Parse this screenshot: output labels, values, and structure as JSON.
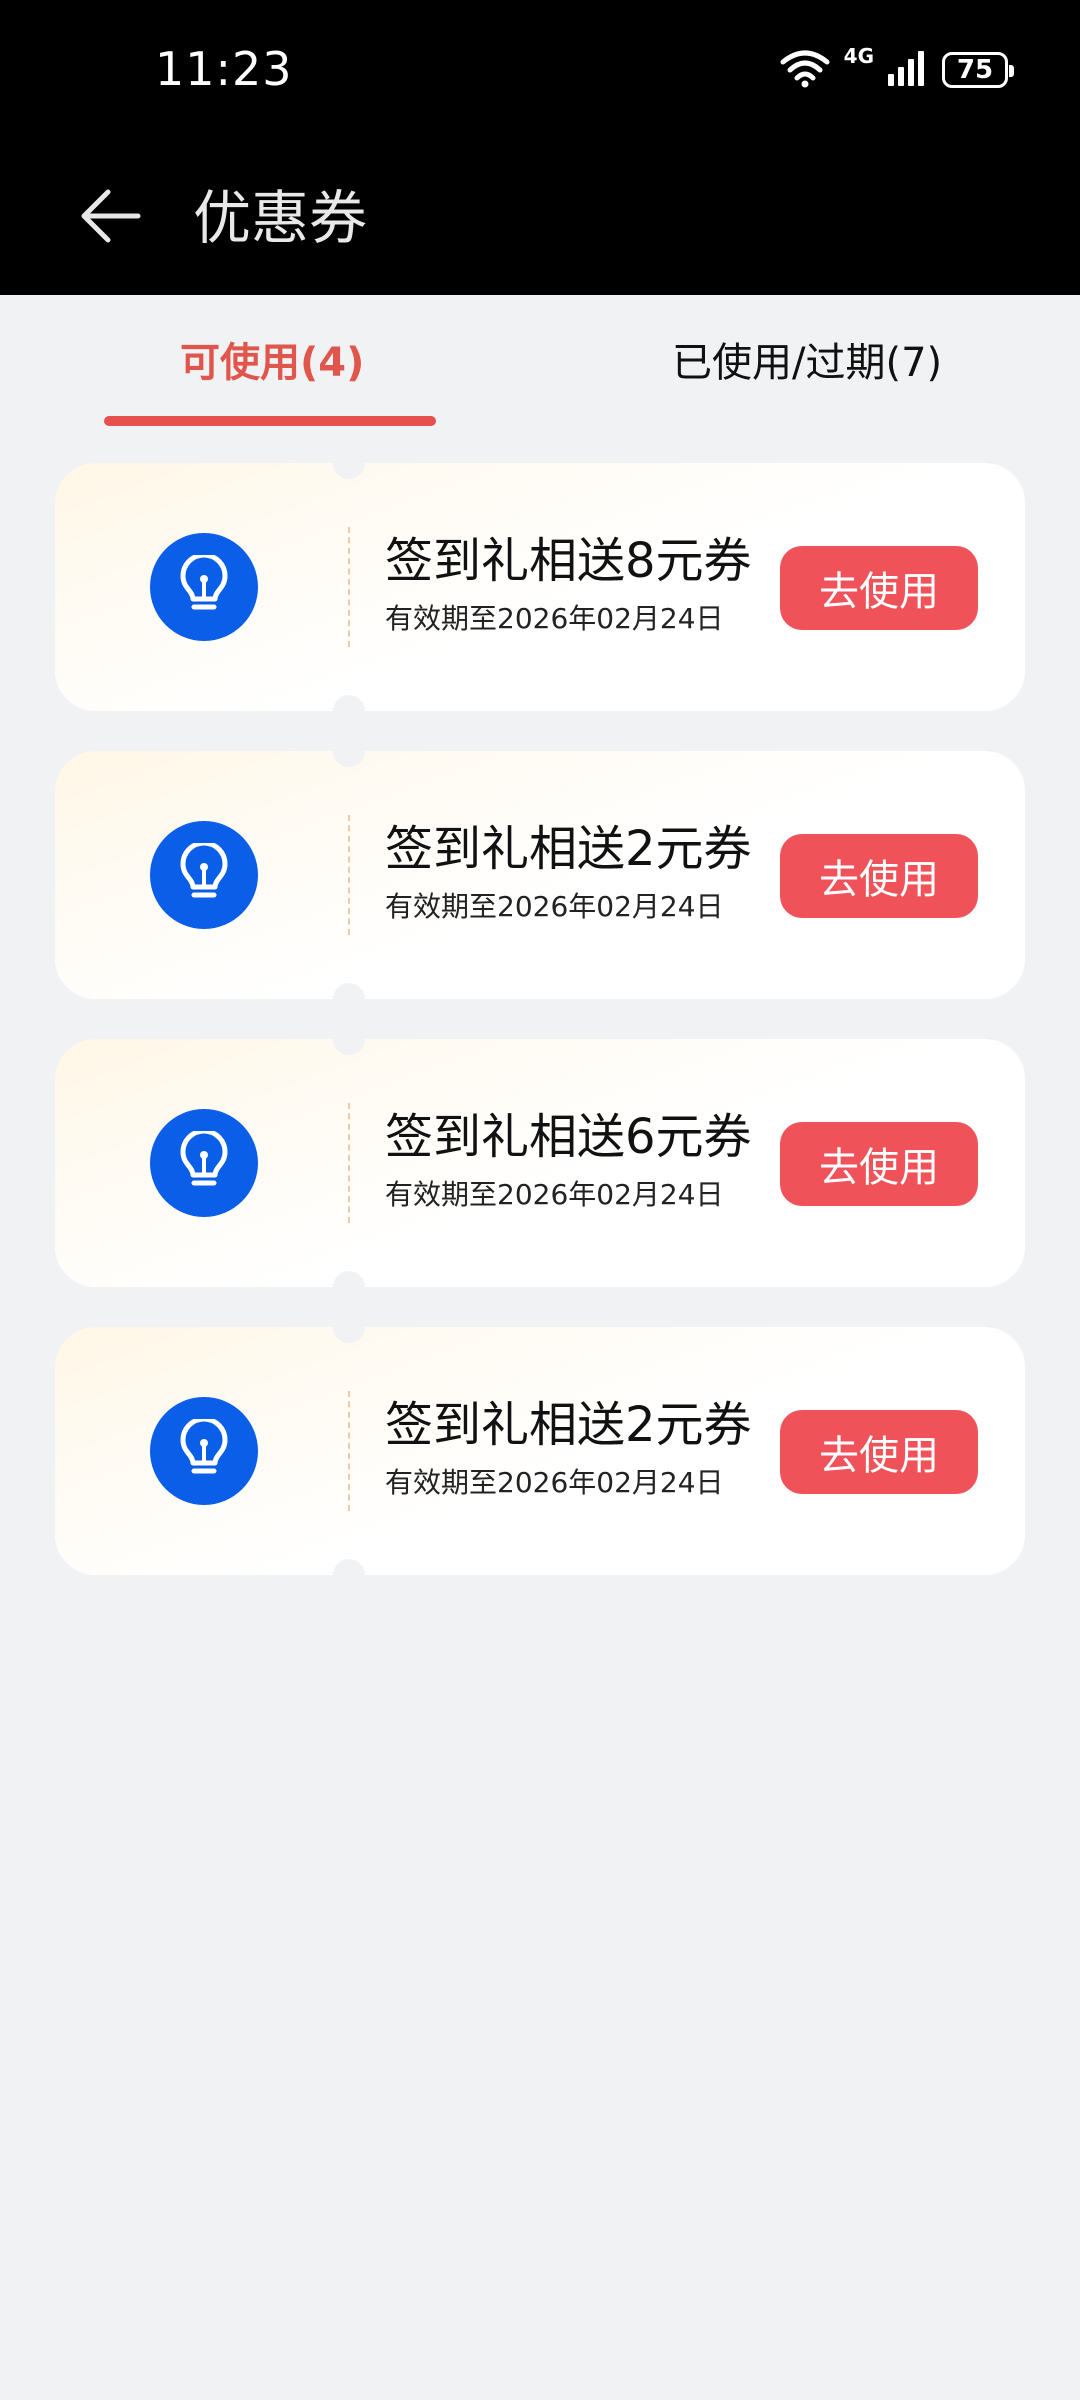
{
  "status_bar": {
    "time": "11:23",
    "network": "4G",
    "battery": "75",
    "icons": [
      "wifi-icon",
      "signal-icon",
      "battery-icon"
    ]
  },
  "header": {
    "title": "优惠券",
    "back_icon": "arrow-left-icon"
  },
  "tabs": [
    {
      "label": "可使用(4)",
      "active": true
    },
    {
      "label": "已使用/过期(7)",
      "active": false
    }
  ],
  "colors": {
    "accent": "#e6504d",
    "button": "#f0525a",
    "icon_bg": "#0a5ee8"
  },
  "coupons": [
    {
      "title": "签到礼相送8元券",
      "expiry": "有效期至2026年02月24日",
      "button": "去使用",
      "icon": "lightbulb-icon"
    },
    {
      "title": "签到礼相送2元券",
      "expiry": "有效期至2026年02月24日",
      "button": "去使用",
      "icon": "lightbulb-icon"
    },
    {
      "title": "签到礼相送6元券",
      "expiry": "有效期至2026年02月24日",
      "button": "去使用",
      "icon": "lightbulb-icon"
    },
    {
      "title": "签到礼相送2元券",
      "expiry": "有效期至2026年02月24日",
      "button": "去使用",
      "icon": "lightbulb-icon"
    }
  ]
}
